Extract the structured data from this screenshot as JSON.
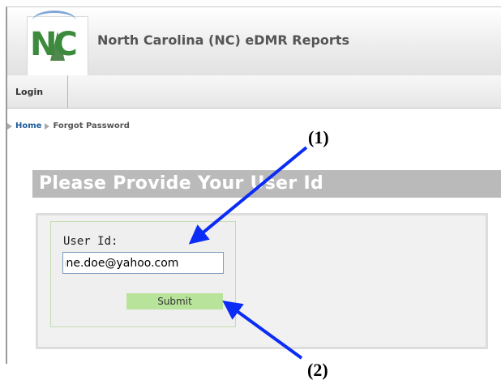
{
  "header": {
    "logo_text": "NC",
    "app_title": "North Carolina (NC) eDMR Reports"
  },
  "nav": {
    "login_label": "Login"
  },
  "breadcrumb": {
    "home_label": "Home",
    "current_label": "Forgot Password"
  },
  "section": {
    "title": "Please Provide Your User Id"
  },
  "form": {
    "user_id_label": "User Id:",
    "user_id_value": "jane.doe@yahoo.com",
    "submit_label": "Submit"
  },
  "annotations": {
    "label_1": "(1)",
    "label_2": "(2)",
    "arrow_color": "#0a2cf5"
  },
  "colors": {
    "link_blue": "#1f5c99",
    "section_bar": "#bababa",
    "submit_green": "#b7e39a"
  }
}
